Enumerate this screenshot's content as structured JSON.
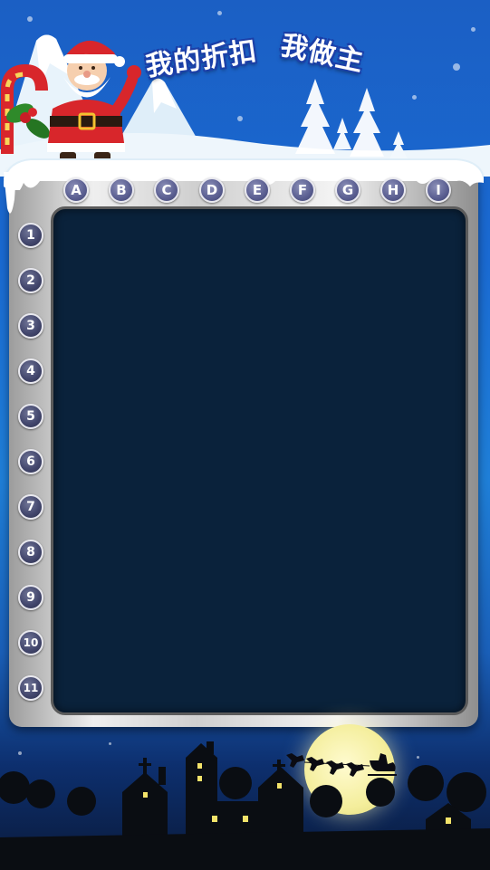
{
  "title": {
    "part1": "我的折扣",
    "part2": "我做主"
  },
  "columns": [
    "A",
    "B",
    "C",
    "D",
    "E",
    "F",
    "G",
    "H",
    "I"
  ],
  "rows": [
    "1",
    "2",
    "3",
    "4",
    "5",
    "6",
    "7",
    "8",
    "9",
    "10",
    "11"
  ],
  "colors": {
    "sky": "#1b5fc4",
    "board": "#0a223b",
    "badge": "#5e6294",
    "moon": "#f4ee9c"
  },
  "decor": {
    "top_left": "santa-with-candy-cane",
    "background": "snowy-mountains-and-trees",
    "bottom": "village-silhouette-with-moon-and-sleigh"
  }
}
